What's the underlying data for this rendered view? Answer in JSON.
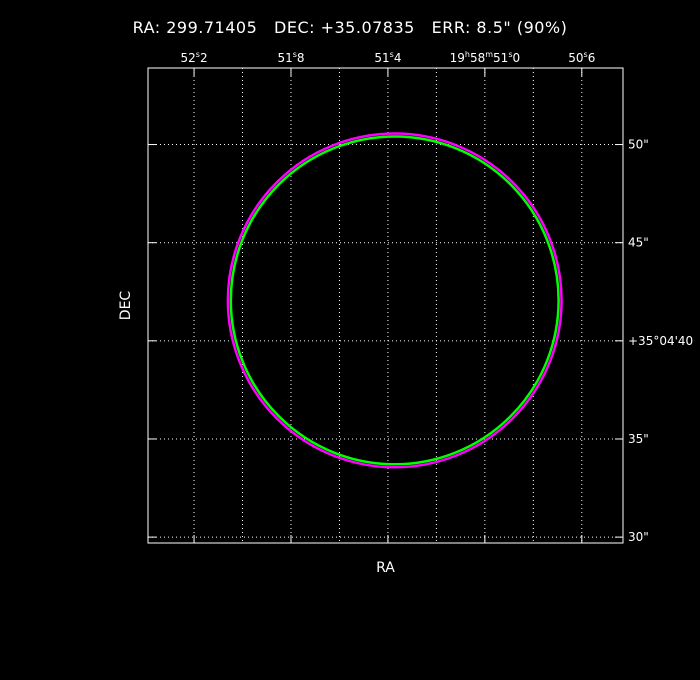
{
  "chart_data": {
    "type": "scatter",
    "title": "RA: 299.71405   DEC: +35.07835   ERR: 8.5\" (90%)",
    "xlabel": "RA",
    "ylabel": "DEC",
    "x_range_ra_sec_of_time": [
      52.39,
      50.43
    ],
    "y_range_dec_arcsec": [
      29.7,
      53.9
    ],
    "x_ticks": [
      {
        "value": 52.2,
        "label": "52.2",
        "label_prefix": "",
        "unit": "s"
      },
      {
        "value": 51.8,
        "label": "51.8",
        "label_prefix": "",
        "unit": "s"
      },
      {
        "value": 51.4,
        "label": "51.4",
        "label_prefix": "",
        "unit": "s"
      },
      {
        "value": 51.0,
        "label": "51.0",
        "label_prefix": "19h58m",
        "unit": "s"
      },
      {
        "value": 50.6,
        "label": "50.6",
        "label_prefix": "",
        "unit": "s"
      }
    ],
    "x_minor_ticks": [
      52.4,
      52.0,
      51.6,
      51.2,
      50.8,
      50.4
    ],
    "y_ticks": [
      {
        "value": 50,
        "label": "50\""
      },
      {
        "value": 45,
        "label": "45\""
      },
      {
        "value": 40,
        "label": "+35°04'40"
      },
      {
        "value": 35,
        "label": "35\""
      },
      {
        "value": 30,
        "label": "30\""
      }
    ],
    "grid": true,
    "circles": [
      {
        "center_ra_deg": 299.71405,
        "center_dec_deg": 35.07835,
        "center_ra_sec": 51.372,
        "center_dec_arcsec": 42.06,
        "radius_arcsec": 8.5,
        "color": "#ff00ff"
      },
      {
        "center_ra_deg": 299.71405,
        "center_dec_deg": 35.07835,
        "center_ra_sec": 51.372,
        "center_dec_arcsec": 42.06,
        "radius_arcsec": 8.35,
        "color": "#00ff00"
      }
    ]
  }
}
